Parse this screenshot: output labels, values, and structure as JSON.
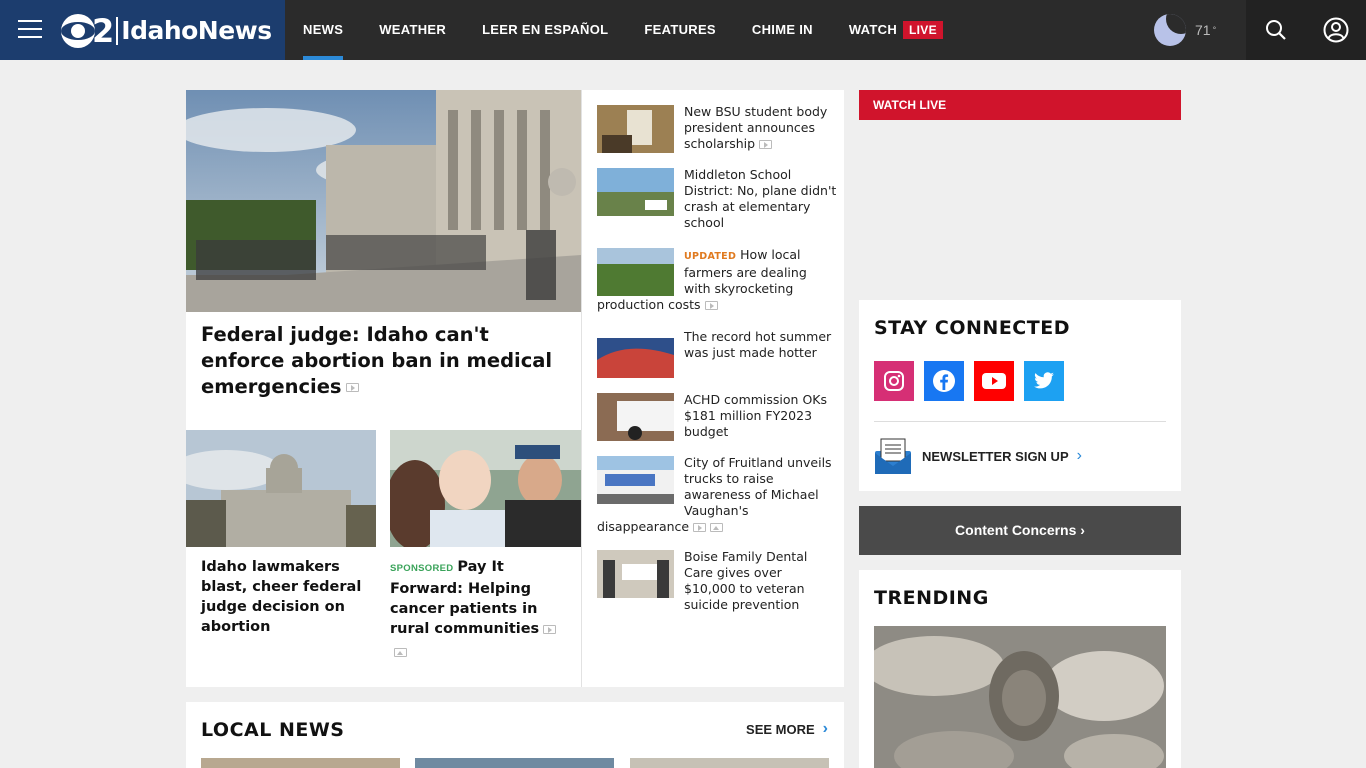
{
  "header": {
    "logo_number": "2",
    "logo_text": "IdahoNews",
    "nav": [
      {
        "label": "NEWS"
      },
      {
        "label": "WEATHER"
      },
      {
        "label": "LEER EN ESPAÑOL"
      },
      {
        "label": "FEATURES"
      },
      {
        "label": "CHIME IN"
      },
      {
        "label": "WATCH"
      }
    ],
    "live_badge": "LIVE",
    "weather": {
      "temp": "71",
      "degree": "°",
      "icon": "moon-icon"
    }
  },
  "main": {
    "hero": {
      "title": "Federal judge: Idaho can't enforce abortion ban in medical emergencies"
    },
    "sub_stories": [
      {
        "title": "Idaho lawmakers blast, cheer federal judge decision on abortion"
      },
      {
        "tag": "SPONSORED",
        "title": "Pay It Forward: Helping cancer patients in rural communities"
      }
    ],
    "stories": [
      {
        "title": "New BSU student body president announces scholarship"
      },
      {
        "title": "Middleton School District: No, plane didn't crash at elementary school"
      },
      {
        "tag": "UPDATED",
        "title": "How local farmers are dealing with skyrocketing production costs"
      },
      {
        "title": "The record hot summer was just made hotter"
      },
      {
        "title": "ACHD commission OKs $181 million FY2023 budget"
      },
      {
        "title": "City of Fruitland unveils trucks to raise awareness of Michael Vaughan's disappearance"
      },
      {
        "title": "Boise Family Dental Care gives over $10,000 to veteran suicide prevention"
      }
    ]
  },
  "local_news": {
    "title": "LOCAL NEWS",
    "see_more": "SEE MORE"
  },
  "sidebar": {
    "watch_live": "WATCH LIVE",
    "stay_connected": "STAY CONNECTED",
    "social": [
      "instagram-icon",
      "facebook-icon",
      "youtube-icon",
      "twitter-icon"
    ],
    "newsletter": "NEWSLETTER SIGN UP",
    "content_concerns": "Content Concerns",
    "trending": "TRENDING"
  },
  "colors": {
    "brand": "#1c3d6e",
    "live": "#d0142c",
    "accent": "#2c8ad8",
    "header": "#2b2b2b"
  }
}
